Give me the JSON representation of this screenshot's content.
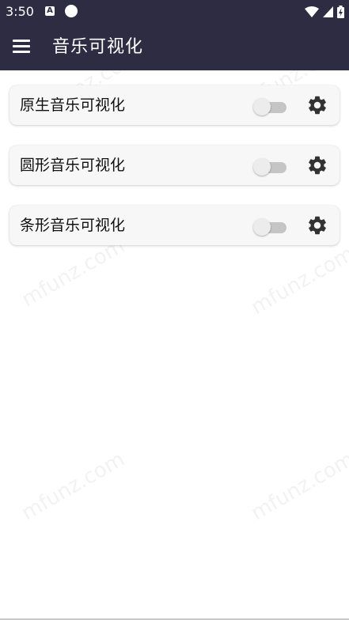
{
  "status_bar": {
    "time": "3:50",
    "notification_icon_letter": "A",
    "icons": [
      "a-notification-icon",
      "circle-notification-icon",
      "wifi-icon",
      "cell-signal-icon",
      "battery-icon"
    ]
  },
  "app_bar": {
    "title": "音乐可视化",
    "menu_icon": "hamburger-menu-icon"
  },
  "items": [
    {
      "label": "原生音乐可视化",
      "enabled": false,
      "settings_icon": "gear-icon"
    },
    {
      "label": "圆形音乐可视化",
      "enabled": false,
      "settings_icon": "gear-icon"
    },
    {
      "label": "条形音乐可视化",
      "enabled": false,
      "settings_icon": "gear-icon"
    }
  ],
  "watermark": "mfunz.com",
  "colors": {
    "header_bg": "#2d2c43",
    "card_bg": "#f7f7f7",
    "switch_track_off": "#c5c5c5",
    "icon_dark": "#333333"
  }
}
